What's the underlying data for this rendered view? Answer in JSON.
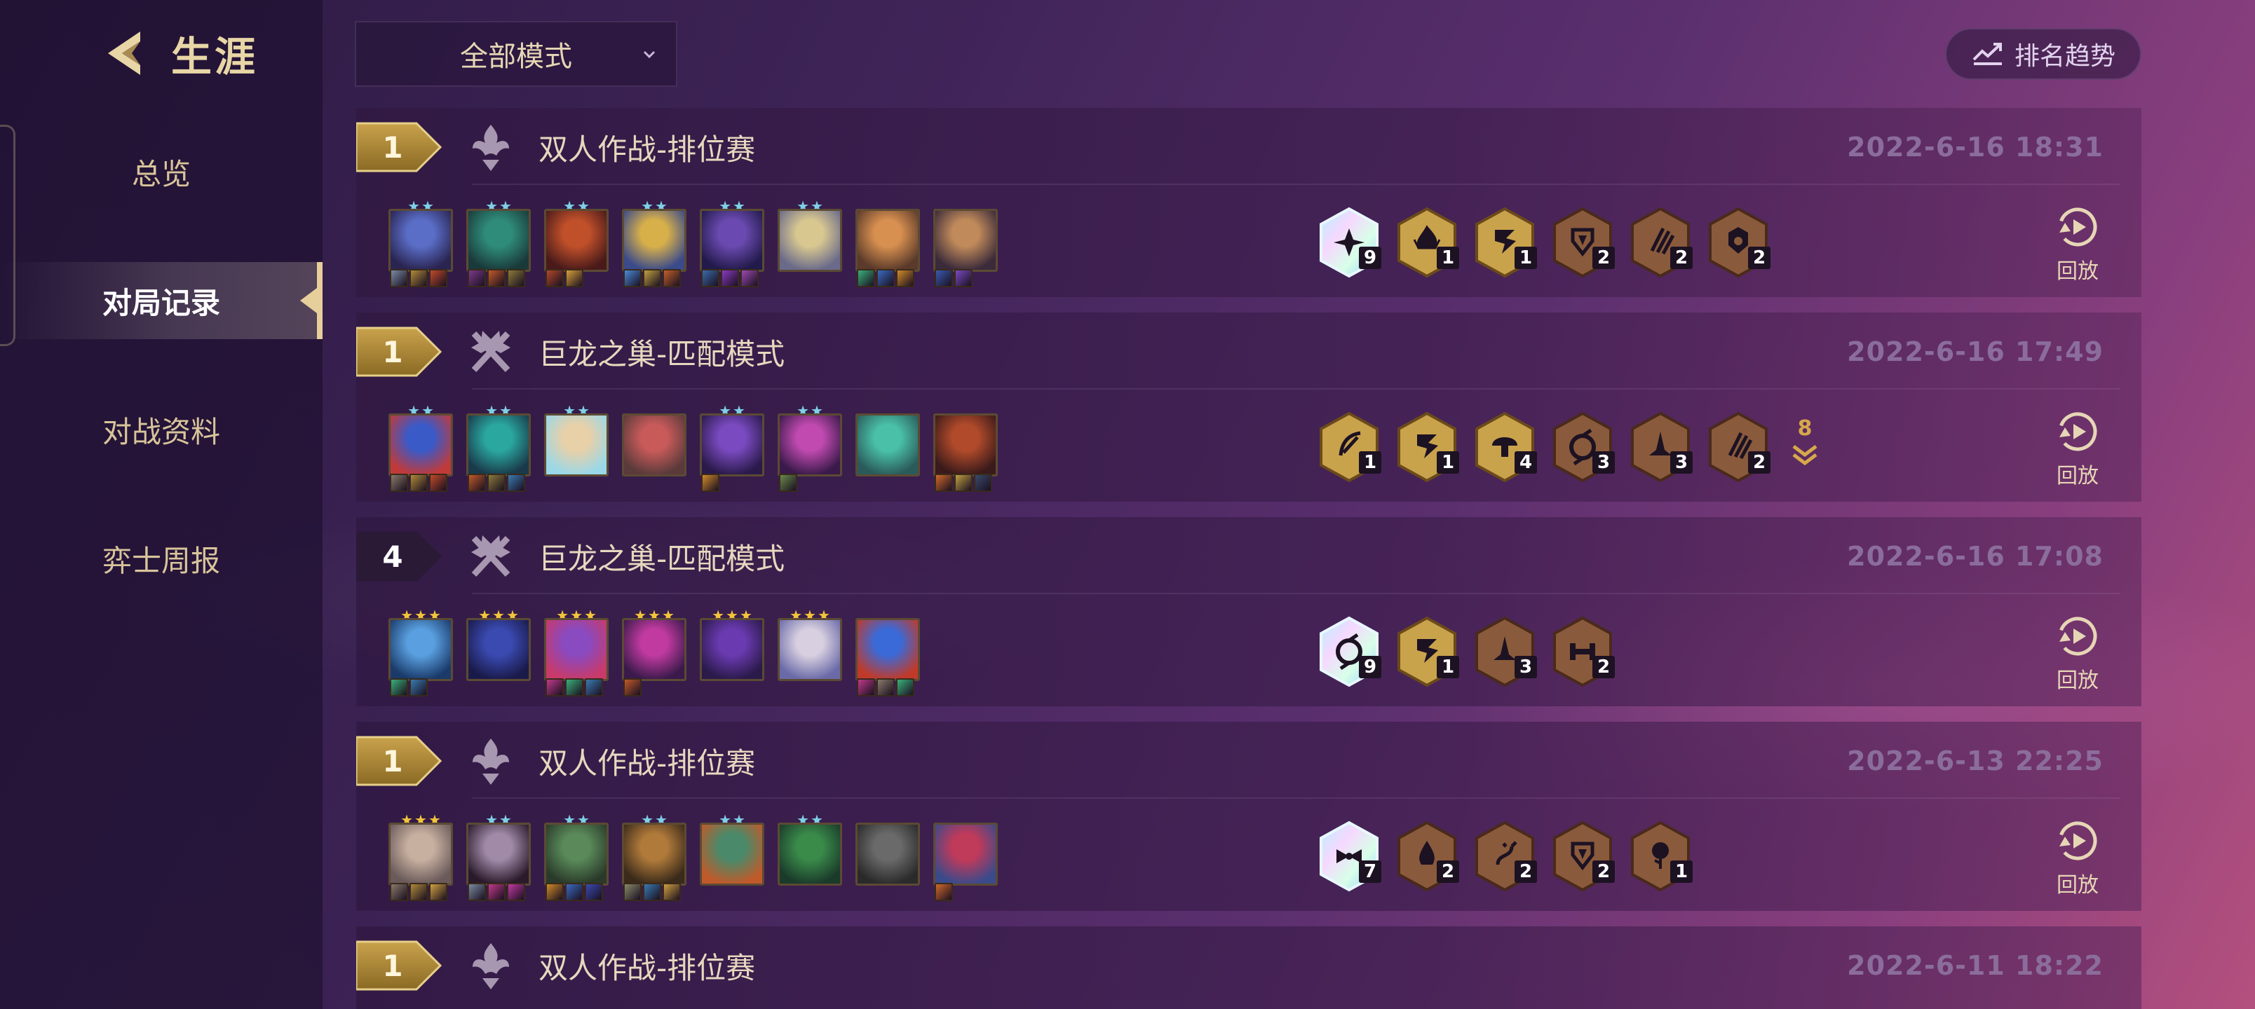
{
  "sidebar": {
    "title": "生涯",
    "items": [
      {
        "label": "总览",
        "active": false
      },
      {
        "label": "对局记录",
        "active": true
      },
      {
        "label": "对战资料",
        "active": false
      },
      {
        "label": "弈士周报",
        "active": false
      }
    ]
  },
  "toolbar": {
    "mode_filter": "全部模式",
    "rank_trend_label": "排名趋势"
  },
  "colors": {
    "gold": "#c9a24c",
    "bronze": "#8a5a3c",
    "prismatic": "#d9f4ff",
    "star_teal": "#7ed0e6",
    "star_gold": "#f3c53a"
  },
  "matches": [
    {
      "place": "1",
      "place_style": "gold",
      "mode_icon": "duo-mode-icon",
      "mode": "双人作战-排位赛",
      "time": "2022-6-16 18:31",
      "units": [
        {
          "stars": 2,
          "star_color": "teal",
          "colors": [
            "#5a6ec8",
            "#2a2450"
          ],
          "items": [
            "#7a8aa0",
            "#b08a3a",
            "#c04a2a"
          ]
        },
        {
          "stars": 2,
          "star_color": "teal",
          "colors": [
            "#2f8c7a",
            "#1a3a3a"
          ],
          "items": [
            "#7a3a8a",
            "#c05a2a",
            "#8a7a3a"
          ]
        },
        {
          "stars": 2,
          "star_color": "teal",
          "colors": [
            "#c0502a",
            "#4a1a1a"
          ],
          "items": [
            "#b0482a",
            "#d8a03a"
          ]
        },
        {
          "stars": 2,
          "star_color": "teal",
          "colors": [
            "#d8b04a",
            "#3a4a8a"
          ],
          "items": [
            "#4a8ad8",
            "#c0a040",
            "#c0602a"
          ]
        },
        {
          "stars": 2,
          "star_color": "teal",
          "colors": [
            "#6a4ab0",
            "#221a4a"
          ],
          "items": [
            "#3a6aa8",
            "#8a3ac0",
            "#9a4ab0"
          ]
        },
        {
          "stars": 2,
          "star_color": "teal",
          "colors": [
            "#d8c890",
            "#6a6a8a"
          ],
          "items": []
        },
        {
          "stars": 0,
          "star_color": "teal",
          "colors": [
            "#d89050",
            "#5a3a2a"
          ],
          "items": [
            "#3ab07a",
            "#3a6ac0",
            "#d08a2a"
          ]
        },
        {
          "stars": 0,
          "star_color": "teal",
          "colors": [
            "#c08a5a",
            "#3a2a3a"
          ],
          "items": [
            "#3a5ab0",
            "#7a4ac0"
          ]
        }
      ],
      "traits": [
        {
          "tier": "prismatic",
          "icon": "trait-star-icon",
          "count": "9"
        },
        {
          "tier": "gold",
          "icon": "trait-flame-icon",
          "count": "1"
        },
        {
          "tier": "gold",
          "icon": "trait-dragon-icon",
          "count": "1"
        },
        {
          "tier": "bronze",
          "icon": "trait-shield-icon",
          "count": "2"
        },
        {
          "tier": "bronze",
          "icon": "trait-claw-icon",
          "count": "2"
        },
        {
          "tier": "bronze",
          "icon": "trait-guardian-icon",
          "count": "2"
        }
      ],
      "extra_traits": "",
      "replay_label": "回放"
    },
    {
      "place": "1",
      "place_style": "gold",
      "mode_icon": "dragon-nest-icon",
      "mode": "巨龙之巢-匹配模式",
      "time": "2022-6-16 17:49",
      "units": [
        {
          "stars": 2,
          "star_color": "teal",
          "colors": [
            "#3a5ac8",
            "#c03a3a"
          ],
          "items": [
            "#8a7a6a",
            "#b08a3a",
            "#c04a2a"
          ]
        },
        {
          "stars": 2,
          "star_color": "teal",
          "colors": [
            "#2aa8a0",
            "#1a3a4a"
          ],
          "items": [
            "#c05a2a",
            "#8a7a3a",
            "#3a7ab0"
          ]
        },
        {
          "stars": 2,
          "star_color": "teal",
          "colors": [
            "#e8d0a8",
            "#9ad8e8"
          ],
          "items": []
        },
        {
          "stars": 0,
          "star_color": "teal",
          "colors": [
            "#c85a5a",
            "#5a3a3a"
          ],
          "items": []
        },
        {
          "stars": 2,
          "star_color": "teal",
          "colors": [
            "#7a4ac0",
            "#2a1a4a"
          ],
          "items": [
            "#d08a2a"
          ]
        },
        {
          "stars": 2,
          "star_color": "teal",
          "colors": [
            "#c04ab0",
            "#3a1a4a"
          ],
          "items": [
            "#6a8a4a"
          ]
        },
        {
          "stars": 0,
          "star_color": "teal",
          "colors": [
            "#4ac0a8",
            "#2a5a5a"
          ],
          "items": []
        },
        {
          "stars": 0,
          "star_color": "teal",
          "colors": [
            "#b04a2a",
            "#3a1a1a"
          ],
          "items": [
            "#d06a2a",
            "#c0a040",
            "#3a4a6a"
          ]
        }
      ],
      "traits": [
        {
          "tier": "gold",
          "icon": "trait-bow-icon",
          "count": "1"
        },
        {
          "tier": "gold",
          "icon": "trait-dragon-icon",
          "count": "1"
        },
        {
          "tier": "gold",
          "icon": "trait-mushroom-icon",
          "count": "4"
        },
        {
          "tier": "bronze",
          "icon": "trait-swirl-icon",
          "count": "3"
        },
        {
          "tier": "bronze",
          "icon": "trait-hat-icon",
          "count": "3"
        },
        {
          "tier": "bronze",
          "icon": "trait-claw-icon",
          "count": "2"
        }
      ],
      "extra_traits": "8",
      "replay_label": "回放"
    },
    {
      "place": "4",
      "place_style": "dark",
      "mode_icon": "dragon-nest-icon",
      "mode": "巨龙之巢-匹配模式",
      "time": "2022-6-16 17:08",
      "units": [
        {
          "stars": 3,
          "star_color": "gold",
          "colors": [
            "#5aa0e0",
            "#1a3a6a"
          ],
          "items": [
            "#3ab07a",
            "#3a7ab0"
          ]
        },
        {
          "stars": 3,
          "star_color": "gold",
          "colors": [
            "#3a4ab0",
            "#1a1a4a"
          ],
          "items": []
        },
        {
          "stars": 3,
          "star_color": "gold",
          "colors": [
            "#8a4ac0",
            "#c83a6a"
          ],
          "items": [
            "#c03a8a",
            "#3ab07a",
            "#3a7ab0"
          ]
        },
        {
          "stars": 3,
          "star_color": "gold",
          "colors": [
            "#c03aa0",
            "#3a1a4a"
          ],
          "items": [
            "#c05a2a"
          ]
        },
        {
          "stars": 3,
          "star_color": "gold",
          "colors": [
            "#6a3ab0",
            "#2a1a4a"
          ],
          "items": []
        },
        {
          "stars": 3,
          "star_color": "gold",
          "colors": [
            "#d8d0e0",
            "#6a6aa8"
          ],
          "items": []
        },
        {
          "stars": 0,
          "star_color": "gold",
          "colors": [
            "#3a6ad8",
            "#c03a2a"
          ],
          "items": [
            "#c03a8a",
            "#8a7a6a",
            "#3ab07a"
          ]
        }
      ],
      "traits": [
        {
          "tier": "prismatic",
          "icon": "trait-swirl-icon",
          "count": "9"
        },
        {
          "tier": "gold",
          "icon": "trait-dragon-icon",
          "count": "1"
        },
        {
          "tier": "bronze",
          "icon": "trait-hat-icon",
          "count": "3"
        },
        {
          "tier": "bronze",
          "icon": "trait-dumbbell-icon",
          "count": "2"
        }
      ],
      "extra_traits": "",
      "replay_label": "回放"
    },
    {
      "place": "1",
      "place_style": "gold",
      "mode_icon": "duo-mode-icon",
      "mode": "双人作战-排位赛",
      "time": "2022-6-13 22:25",
      "units": [
        {
          "stars": 3,
          "star_color": "gold",
          "colors": [
            "#c8b0a0",
            "#6a5a5a"
          ],
          "items": [
            "#8a7a6a",
            "#b08a3a",
            "#d0a040"
          ]
        },
        {
          "stars": 2,
          "star_color": "teal",
          "colors": [
            "#a08aa8",
            "#2a1a2a"
          ],
          "items": [
            "#7a8aa0",
            "#c03a8a",
            "#c03aa0"
          ]
        },
        {
          "stars": 2,
          "star_color": "teal",
          "colors": [
            "#5a8a5a",
            "#2a3a2a"
          ],
          "items": [
            "#d08a2a",
            "#3a6ac0",
            "#3a4ab0"
          ]
        },
        {
          "stars": 2,
          "star_color": "teal",
          "colors": [
            "#b07a3a",
            "#3a2a1a"
          ],
          "items": [
            "#8a8a6a",
            "#3a7ab0",
            "#d0a040"
          ]
        },
        {
          "stars": 2,
          "star_color": "teal",
          "colors": [
            "#4a8a6a",
            "#c05a2a"
          ],
          "items": []
        },
        {
          "stars": 2,
          "star_color": "teal",
          "colors": [
            "#3a8a4a",
            "#1a3a2a"
          ],
          "items": []
        },
        {
          "stars": 0,
          "star_color": "teal",
          "colors": [
            "#6a6a6a",
            "#2a2a2a"
          ],
          "items": []
        },
        {
          "stars": 0,
          "star_color": "teal",
          "colors": [
            "#c03a5a",
            "#3a4a8a"
          ],
          "items": [
            "#d06a2a"
          ]
        }
      ],
      "traits": [
        {
          "tier": "prismatic",
          "icon": "trait-bowtie-icon",
          "count": "7"
        },
        {
          "tier": "bronze",
          "icon": "trait-drop-icon",
          "count": "2"
        },
        {
          "tier": "bronze",
          "icon": "trait-spark-icon",
          "count": "2"
        },
        {
          "tier": "bronze",
          "icon": "trait-shield-icon",
          "count": "2"
        },
        {
          "tier": "bronze",
          "icon": "trait-rose-icon",
          "count": "1"
        }
      ],
      "extra_traits": "",
      "replay_label": "回放"
    },
    {
      "place": "1",
      "place_style": "gold",
      "mode_icon": "duo-mode-icon",
      "mode": "双人作战-排位赛",
      "time": "2022-6-11 18:22",
      "units": [],
      "traits": [],
      "extra_traits": "",
      "replay_label": ""
    }
  ]
}
